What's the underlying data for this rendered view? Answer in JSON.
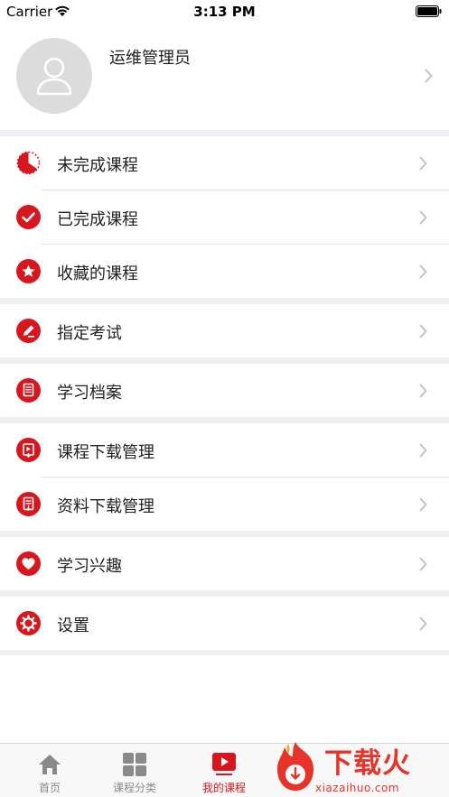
{
  "status_bar": {
    "carrier": "Carrier",
    "time": "3:13 PM"
  },
  "profile": {
    "name": "运维管理员",
    "avatar_icon": "person-placeholder-icon"
  },
  "menu": [
    {
      "label": "未完成课程",
      "icon": "half-circle-progress-icon"
    },
    {
      "label": "已完成课程",
      "icon": "checkmark-circle-icon"
    },
    {
      "label": "收藏的课程",
      "icon": "star-icon"
    },
    {
      "label": "指定考试",
      "icon": "pencil-icon"
    },
    {
      "label": "学习档案",
      "icon": "document-icon"
    },
    {
      "label": "课程下载管理",
      "icon": "video-download-icon"
    },
    {
      "label": "资料下载管理",
      "icon": "file-download-icon"
    },
    {
      "label": "学习兴趣",
      "icon": "heart-icon"
    },
    {
      "label": "设置",
      "icon": "settings-gear-icon"
    }
  ],
  "tabs": [
    {
      "label": "首页",
      "icon": "home-icon",
      "active": false
    },
    {
      "label": "课程分类",
      "icon": "grid-icon",
      "active": false
    },
    {
      "label": "我的课程",
      "icon": "play-video-icon",
      "active": true
    }
  ],
  "watermark": {
    "title": "下载火",
    "domain": "xiazaihuo.com"
  },
  "colors": {
    "accent": "#d7161e",
    "background": "#efeff4",
    "tab_inactive": "#8a8a8a",
    "watermark": "#e8332a"
  }
}
